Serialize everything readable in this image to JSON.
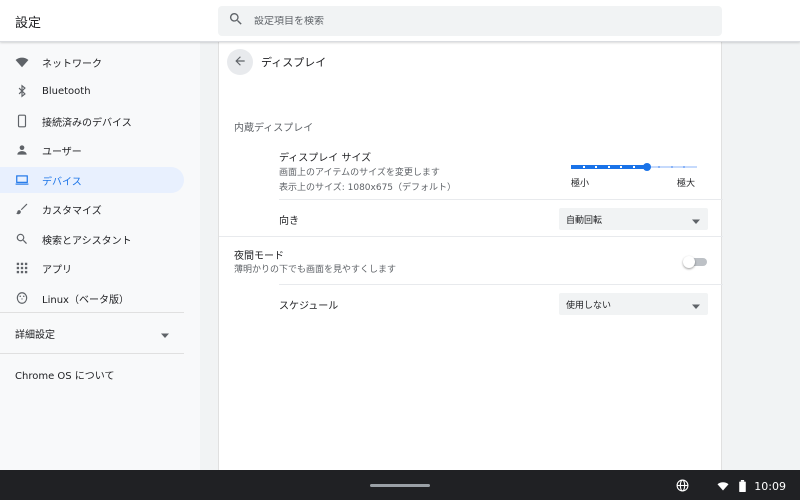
{
  "header": {
    "title": "設定",
    "search_placeholder": "設定項目を検索"
  },
  "sidebar": {
    "items": [
      {
        "label": "ネットワーク",
        "icon": "wifi-icon"
      },
      {
        "label": "Bluetooth",
        "icon": "bluetooth-icon"
      },
      {
        "label": "接続済みのデバイス",
        "icon": "phone-icon"
      },
      {
        "label": "ユーザー",
        "icon": "person-icon"
      },
      {
        "label": "デバイス",
        "icon": "laptop-icon",
        "selected": true
      },
      {
        "label": "カスタマイズ",
        "icon": "brush-icon"
      },
      {
        "label": "検索とアシスタント",
        "icon": "search-icon"
      },
      {
        "label": "アプリ",
        "icon": "apps-grid-icon"
      },
      {
        "label": "Linux（ベータ版）",
        "icon": "penguin-icon"
      }
    ],
    "advanced_label": "詳細設定",
    "about_label": "Chrome OS について"
  },
  "main": {
    "page_title": "ディスプレイ",
    "section_title": "内蔵ディスプレイ",
    "display_size": {
      "title": "ディスプレイ サイズ",
      "description": "画面上のアイテムのサイズを変更します",
      "resolution": "表示上のサイズ: 1080x675（デフォルト）",
      "min_label": "極小",
      "max_label": "極大",
      "steps": 11,
      "current_step": 6
    },
    "orientation": {
      "label": "向き",
      "value": "自動回転"
    },
    "night_light": {
      "title": "夜間モード",
      "description": "薄明かりの下でも画面を見やすくします",
      "enabled": false
    },
    "schedule": {
      "label": "スケジュール",
      "value": "使用しない"
    }
  },
  "shelf": {
    "time": "10:09"
  },
  "colors": {
    "accent": "#1a73e8",
    "selected_bg": "#e8f0fe",
    "shelf": "#202124"
  }
}
